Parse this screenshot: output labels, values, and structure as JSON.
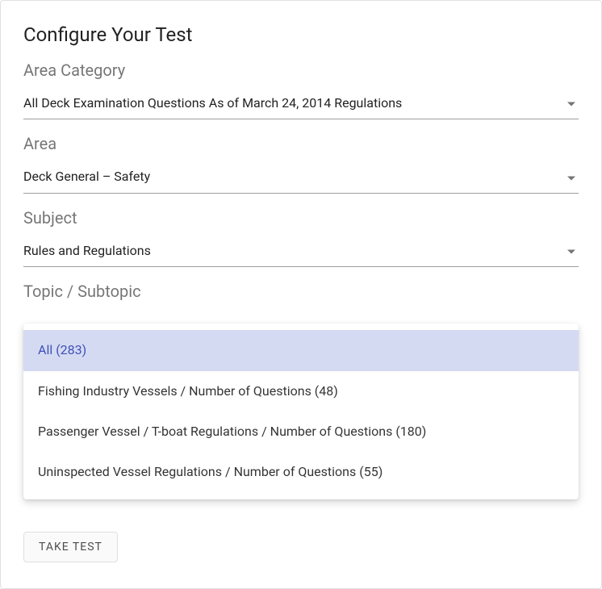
{
  "title": "Configure Your Test",
  "labels": {
    "areaCategory": "Area Category",
    "area": "Area",
    "subject": "Subject",
    "topic": "Topic / Subtopic"
  },
  "selects": {
    "areaCategory": {
      "value": "All Deck Examination Questions As of March 24, 2014 Regulations"
    },
    "area": {
      "value": "Deck General – Safety"
    },
    "subject": {
      "value": "Rules and Regulations"
    }
  },
  "topicOptions": [
    {
      "label": "All (283)",
      "selected": true
    },
    {
      "label": "Fishing Industry Vessels / Number of Questions (48)",
      "selected": false
    },
    {
      "label": "Passenger Vessel / T-boat Regulations / Number of Questions (180)",
      "selected": false
    },
    {
      "label": "Uninspected Vessel Regulations / Number of Questions (55)",
      "selected": false
    }
  ],
  "buttons": {
    "takeTest": "TAKE TEST"
  }
}
